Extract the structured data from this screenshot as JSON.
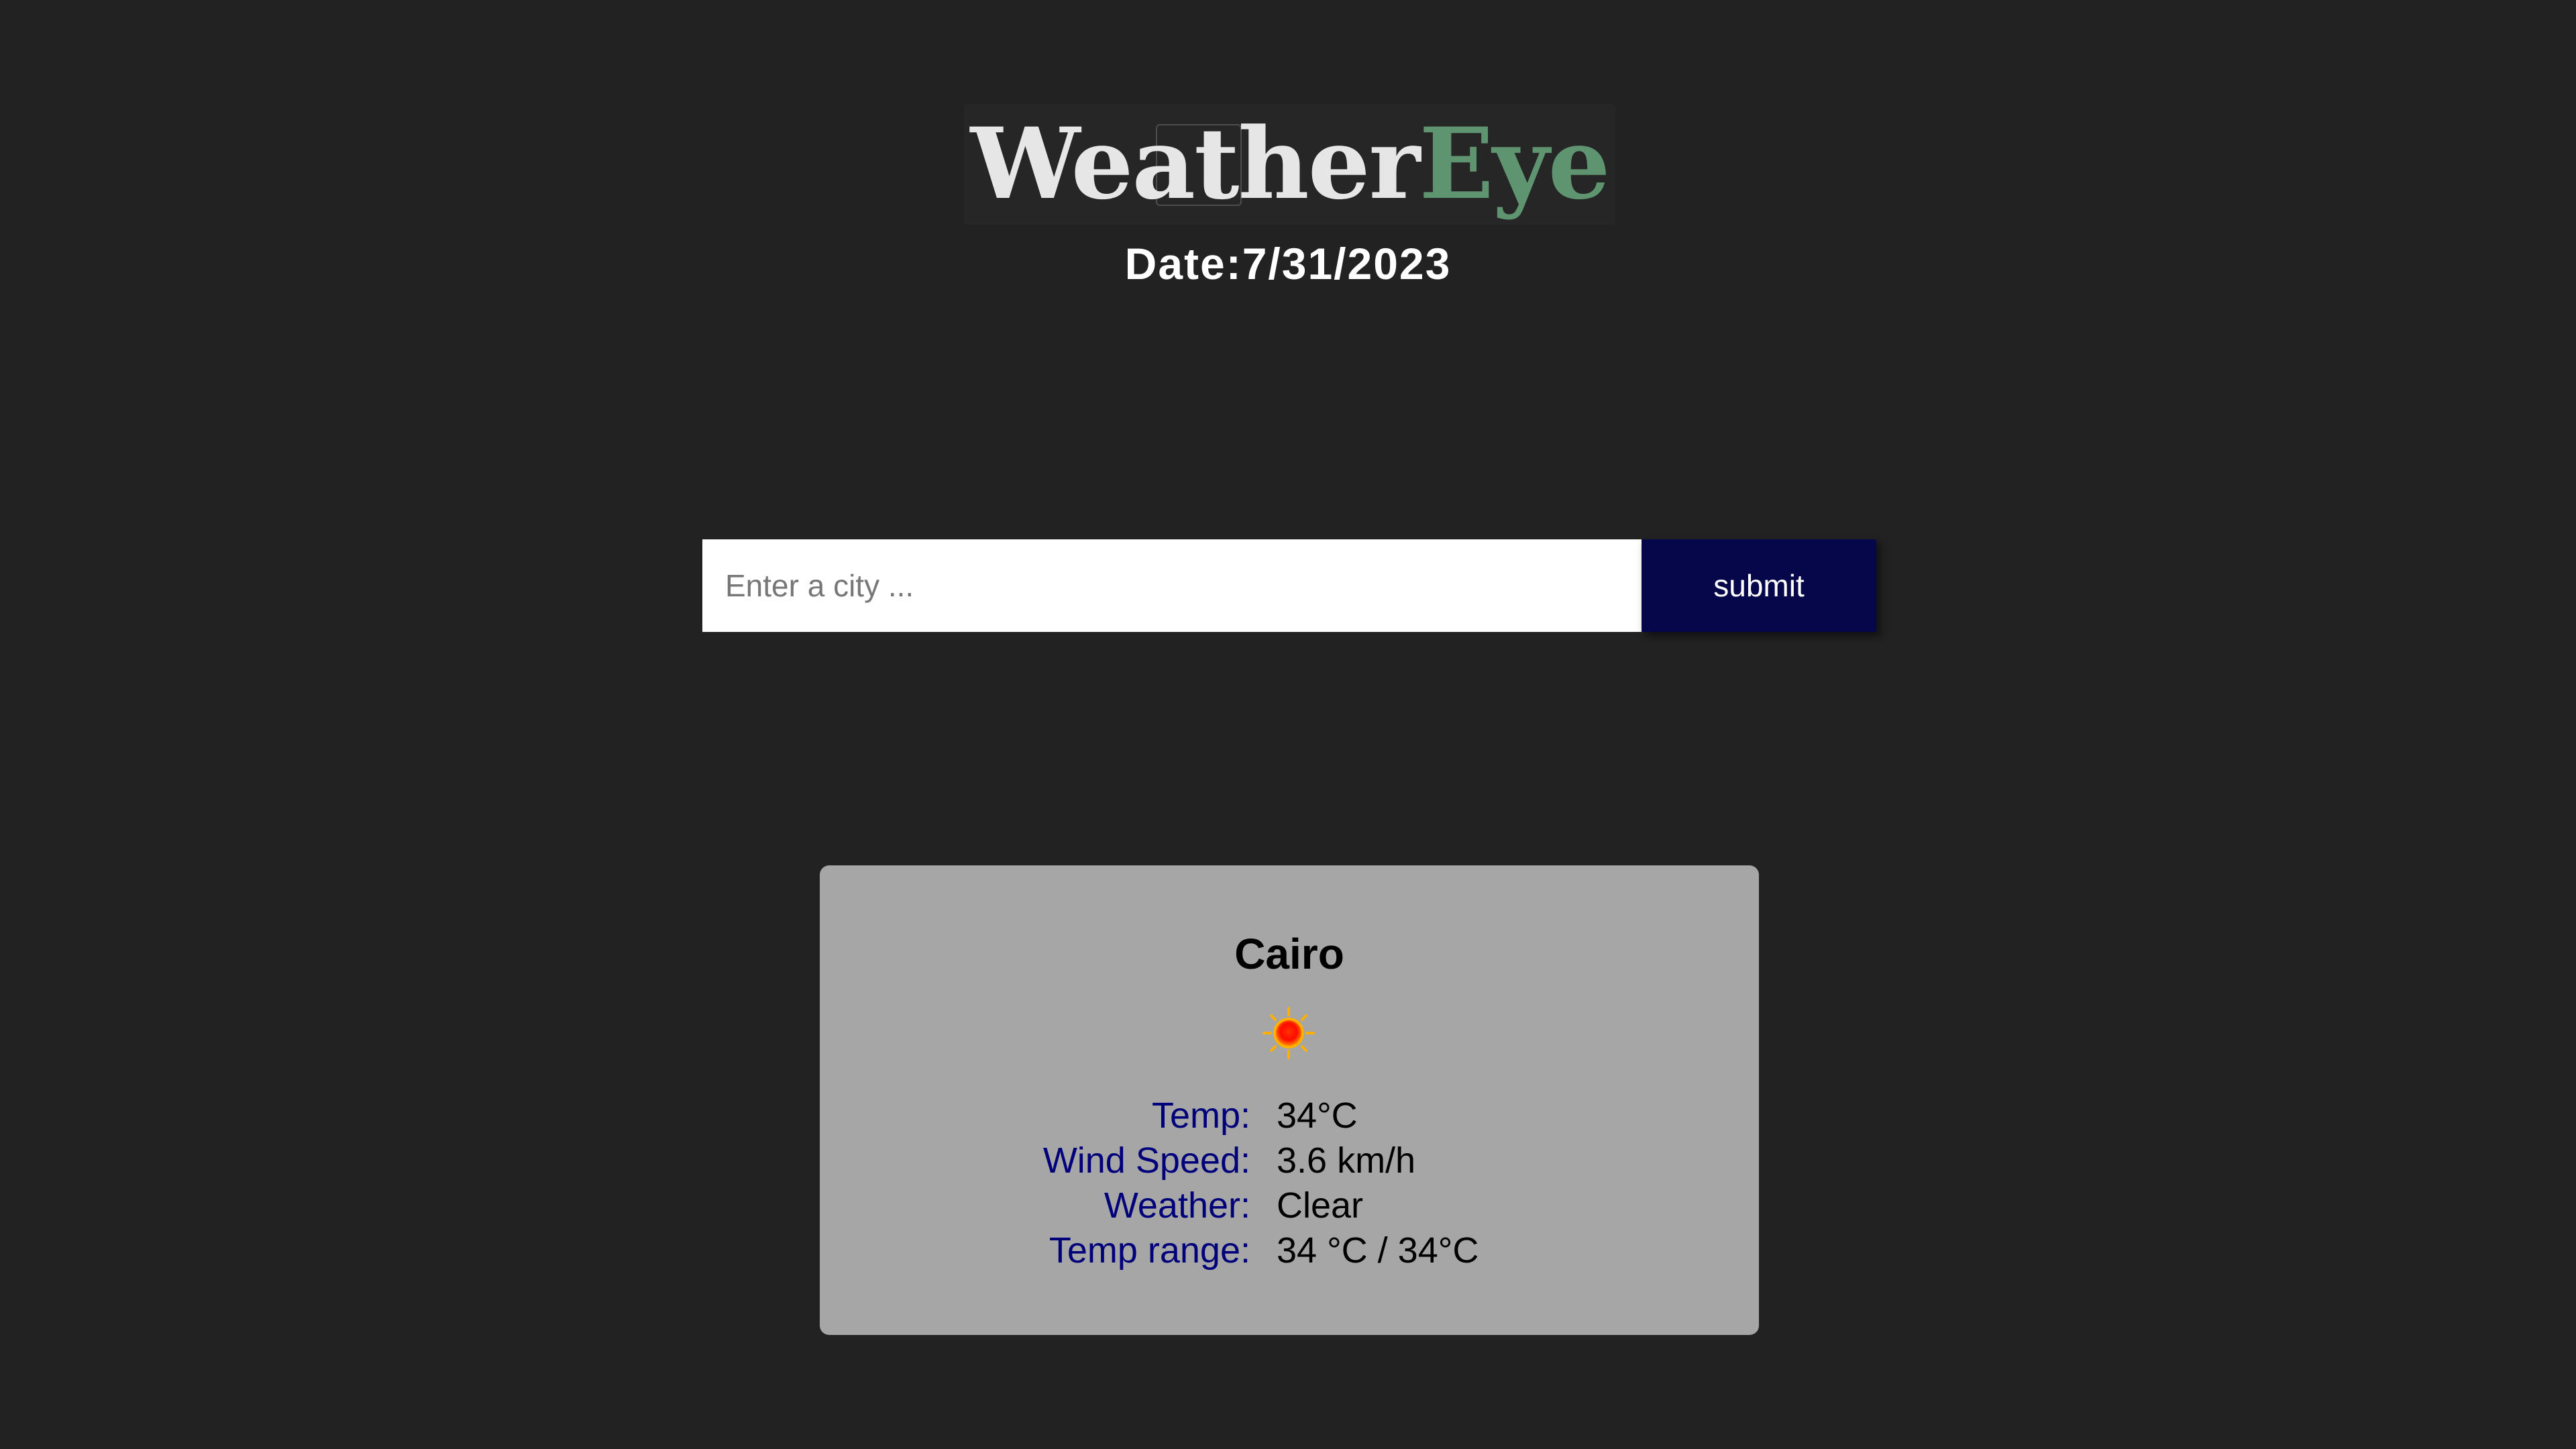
{
  "header": {
    "logo_part1": "Weather",
    "logo_part2": "Eye",
    "date_label": "Date:",
    "date_value": "7/31/2023"
  },
  "search": {
    "placeholder": "Enter a city ...",
    "value": "",
    "submit_label": "submit"
  },
  "card": {
    "city": "Cairo",
    "icon": "sun-icon",
    "stats": [
      {
        "label": "Temp:",
        "value": "34°C"
      },
      {
        "label": "Wind Speed:",
        "value": "3.6 km/h"
      },
      {
        "label": "Weather:",
        "value": "Clear"
      },
      {
        "label": "Temp range:",
        "value": "34 °C / 34°C"
      }
    ]
  },
  "colors": {
    "background": "#222222",
    "logo_accent": "#5f9470",
    "submit_button": "#06064a",
    "card_background": "#a6a6a6",
    "stat_label": "#00007a"
  }
}
